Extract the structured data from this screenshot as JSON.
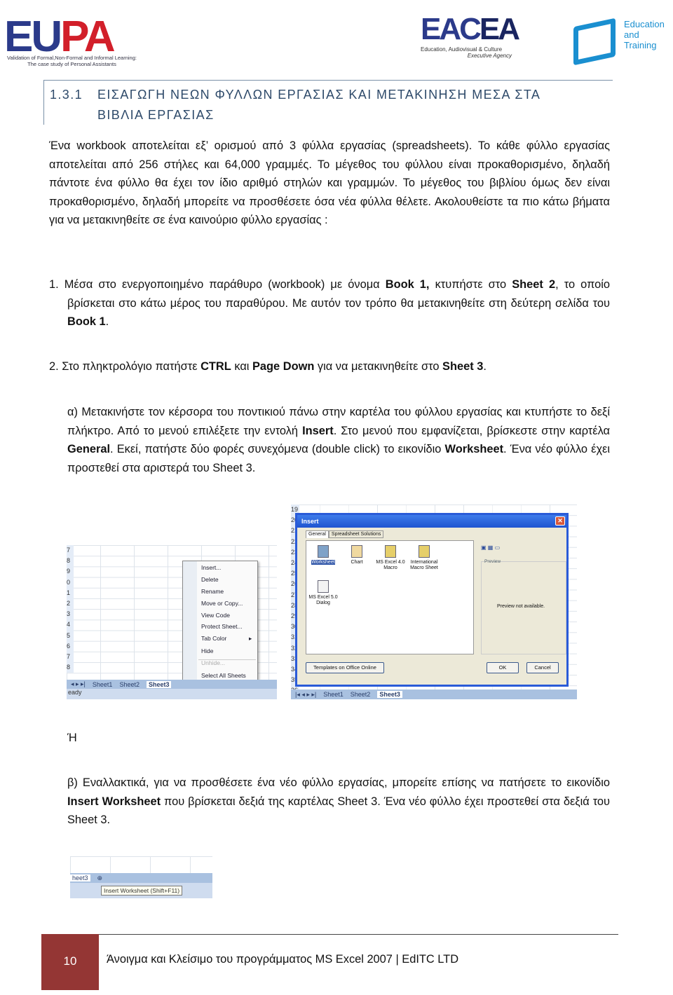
{
  "header": {
    "eupa_logo": {
      "text": "EUPA",
      "tagline_1": "Validation of Formal,Non-Formal and Informal Learning:",
      "tagline_2": "The case study of Personal Assistants",
      "colors": {
        "eu": "#2b3a8a",
        "pa": "#d21f2a"
      }
    },
    "eacea_logo": {
      "text_1": "EAC",
      "text_2": "EA",
      "tagline_1": "Education, Audiovisual & Culture",
      "tagline_2": "Executive Agency"
    },
    "et_logo": {
      "line_1": "Education",
      "line_2": "and",
      "line_3": "Training"
    }
  },
  "heading": {
    "number": "1.3.1",
    "title": "ΕΙΣΑΓΩΓΗ ΝΕΩΝ ΦΥΛΛΩΝ ΕΡΓΑΣΙΑΣ ΚΑΙ ΜΕΤΑΚΙΝΗΣΗ ΜΕΣΑ ΣΤΑ ΒΙΒΛΙΑ ΕΡΓΑΣΙΑΣ"
  },
  "paragraphs": {
    "intro": [
      {
        "t": "Ένα workbook αποτελείται εξ’ ορισμού από 3 φύλλα εργασίας (spreadsheets).  Το κάθε φύλλο εργασίας αποτελείται από 256 στήλες και 64,000 γραμμές. Το μέγεθος του φύλλου είναι προκαθορισμένο, δηλαδή πάντοτε ένα φύλλο θα έχει τον ίδιο αριθμό στηλών και γραμμών. Το μέγεθος του βιβλίου όμως δεν είναι προκαθορισμένο, δηλαδή μπορείτε να προσθέσετε όσα νέα φύλλα θέλετε. Ακολουθείστε τα πιο κάτω βήματα για να μετακινηθείτε σε ένα καινούριο φύλλο εργασίας :"
      }
    ],
    "step1": [
      {
        "t": "1. Μέσα στο ενεργοποιημένο παράθυρο (workbook) με όνομα "
      },
      {
        "t": "Book 1,",
        "b": true
      },
      {
        "t": " κτυπήστε στο "
      },
      {
        "t": "Sheet 2",
        "b": true
      },
      {
        "t": ", το οποίο βρίσκεται στο κάτω μέρος του παραθύρου. Με αυτόν τον τρόπο θα μετακινηθείτε στη δεύτερη σελίδα του "
      },
      {
        "t": "Book 1",
        "b": true
      },
      {
        "t": "."
      }
    ],
    "step2": [
      {
        "t": "2. Στο πληκτρολόγιο πατήστε "
      },
      {
        "t": "CTRL",
        "b": true
      },
      {
        "t": " και "
      },
      {
        "t": "Page Down",
        "b": true
      },
      {
        "t": " για να μετακινηθείτε στο "
      },
      {
        "t": "Sheet 3",
        "b": true
      },
      {
        "t": "."
      }
    ],
    "step_a": [
      {
        "t": "α) Μετακινήστε τον κέρσορα του ποντικιού πάνω στην καρτέλα του φύλλου εργασίας και κτυπήστε το δεξί πλήκτρο. Από το μενού επιλέξετε την εντολή "
      },
      {
        "t": "Insert",
        "b": true
      },
      {
        "t": ". Στο μενού που εμφανίζεται, βρίσκεστε στην καρτέλα "
      },
      {
        "t": "General",
        "b": true
      },
      {
        "t": ". Εκεί, πατήστε δύο φορές συνεχόμενα (double click) το εικονίδιο "
      },
      {
        "t": "Worksheet",
        "b": true
      },
      {
        "t": ". Ένα νέο φύλλο έχει προστεθεί στα αριστερά του Sheet 3."
      }
    ],
    "or": [
      {
        "t": "Ή"
      }
    ],
    "step_b": [
      {
        "t": "β) Εναλλακτικά, για να προσθέσετε ένα νέο φύλλο εργασίας, μπορείτε επίσης να πατήσετε το εικονίδιο "
      },
      {
        "t": "Insert Worksheet",
        "b": true
      },
      {
        "t": " που βρίσκεται δεξιά της καρτέλας Sheet 3. Ένα νέο φύλλο έχει προστεθεί στα δεξιά του Sheet 3."
      }
    ]
  },
  "screenshot_context_menu": {
    "row_numbers": [
      "7",
      "8",
      "9",
      "0",
      "1",
      "2",
      "3",
      "4",
      "5",
      "6",
      "7",
      "8"
    ],
    "menu_items": [
      "Insert...",
      "Delete",
      "Rename",
      "Move or Copy...",
      "View Code",
      "Protect Sheet...",
      "Tab Color",
      "Hide",
      "Unhide...",
      "Select All Sheets"
    ],
    "tabs": [
      "Sheet1",
      "Sheet2",
      "Sheet3"
    ],
    "status": "eady"
  },
  "screenshot_insert_dialog": {
    "title": "Insert",
    "close": "✕",
    "tabs": [
      "General",
      "Spreadsheet Solutions"
    ],
    "icons": [
      "Worksheet",
      "Chart",
      "MS Excel 4.0 Macro",
      "International Macro Sheet",
      "MS Excel 5.0 Dialog"
    ],
    "preview_label": "Preview",
    "preview_text": "Preview not available.",
    "templates_button": "Templates on Office Online",
    "ok_button": "OK",
    "cancel_button": "Cancel",
    "row_numbers": [
      "19",
      "20",
      "21",
      "22",
      "23",
      "24",
      "25",
      "26",
      "27",
      "28",
      "29",
      "30",
      "31",
      "32",
      "33",
      "34",
      "35",
      "36",
      "37",
      "38"
    ],
    "sheet_tabs": [
      "Sheet1",
      "Sheet2",
      "Sheet3"
    ]
  },
  "screenshot_insert_worksheet": {
    "tab": "heet3",
    "tooltip": "Insert Worksheet (Shift+F11)"
  },
  "footer": {
    "page_number": "10",
    "text": "Άνοιγμα και Κλείσιμο του προγράμματος MS Excel 2007 | EdITC LTD",
    "accent_color": "#943634"
  }
}
